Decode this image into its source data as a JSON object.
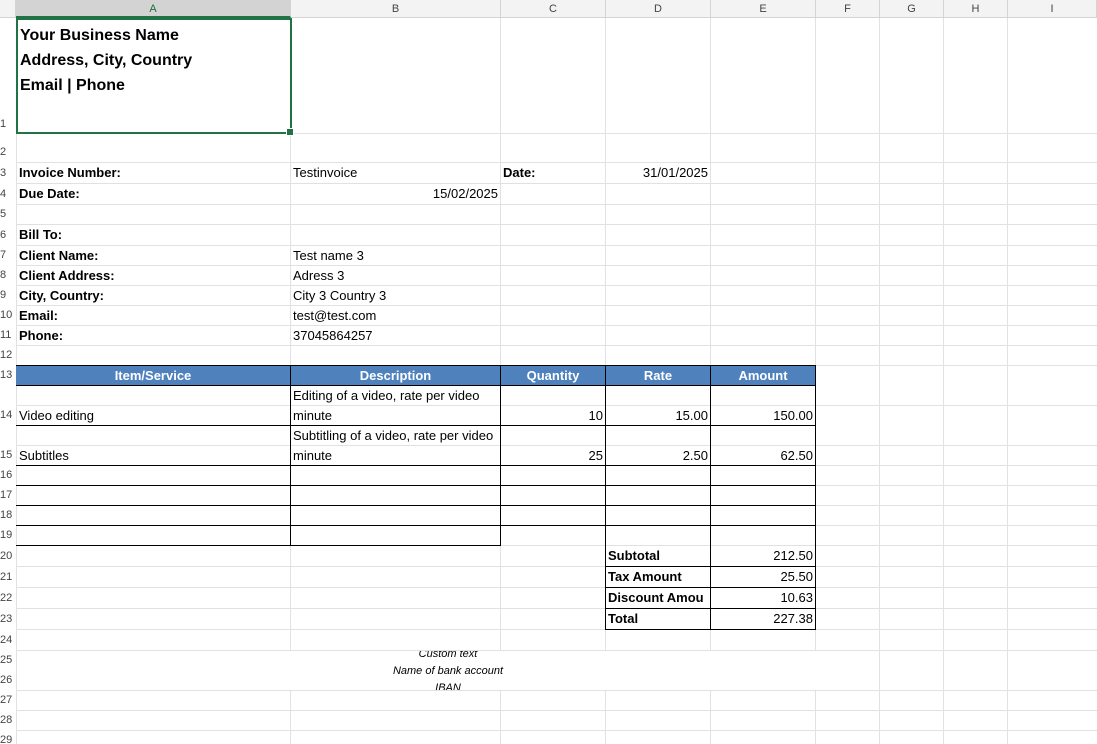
{
  "columns": [
    "A",
    "B",
    "C",
    "D",
    "E",
    "F",
    "G",
    "H",
    "I"
  ],
  "rows": [
    "1",
    "2",
    "3",
    "4",
    "5",
    "6",
    "7",
    "8",
    "9",
    "10",
    "11",
    "12",
    "13",
    "14",
    "15",
    "16",
    "17",
    "18",
    "19",
    "20",
    "21",
    "22",
    "23",
    "24",
    "25",
    "26",
    "27",
    "28",
    "29"
  ],
  "header": {
    "business_name": "Your Business Name",
    "address": "Address, City, Country",
    "contact": "Email | Phone"
  },
  "invoice": {
    "number_label": "Invoice Number:",
    "number_value": "Testinvoice",
    "date_label": "Date:",
    "date_value": "31/01/2025",
    "due_label": "Due Date:",
    "due_value": "15/02/2025"
  },
  "bill_to": {
    "title": "Bill To:",
    "fields": [
      {
        "label": "Client Name:",
        "value": "Test name 3"
      },
      {
        "label": "Client Address:",
        "value": "Adress 3"
      },
      {
        "label": "City, Country:",
        "value": "City 3 Country 3"
      },
      {
        "label": "Email:",
        "value": "test@test.com"
      },
      {
        "label": "Phone:",
        "value": "37045864257"
      }
    ]
  },
  "items_table": {
    "headers": [
      "Item/Service",
      "Description",
      "Quantity",
      "Rate",
      "Amount"
    ],
    "rows": [
      {
        "item": "Video editing",
        "description": "Editing of a video, rate per video minute",
        "quantity": "10",
        "rate": "15.00",
        "amount": "150.00"
      },
      {
        "item": "Subtitles",
        "description": "Subtitling of a video, rate per video minute",
        "quantity": "25",
        "rate": "2.50",
        "amount": "62.50"
      }
    ]
  },
  "totals": [
    {
      "label": "Subtotal",
      "value": "212.50"
    },
    {
      "label": "Tax Amount",
      "value": "25.50"
    },
    {
      "label": "Discount Amou",
      "value": "10.63"
    },
    {
      "label": "Total",
      "value": "227.38"
    }
  ],
  "footer": {
    "line1": "Custom text",
    "line2": "Name of bank account",
    "line3": "IBAN"
  },
  "colors": {
    "table_header_bg": "#4f81bd",
    "selection_border": "#217346"
  }
}
